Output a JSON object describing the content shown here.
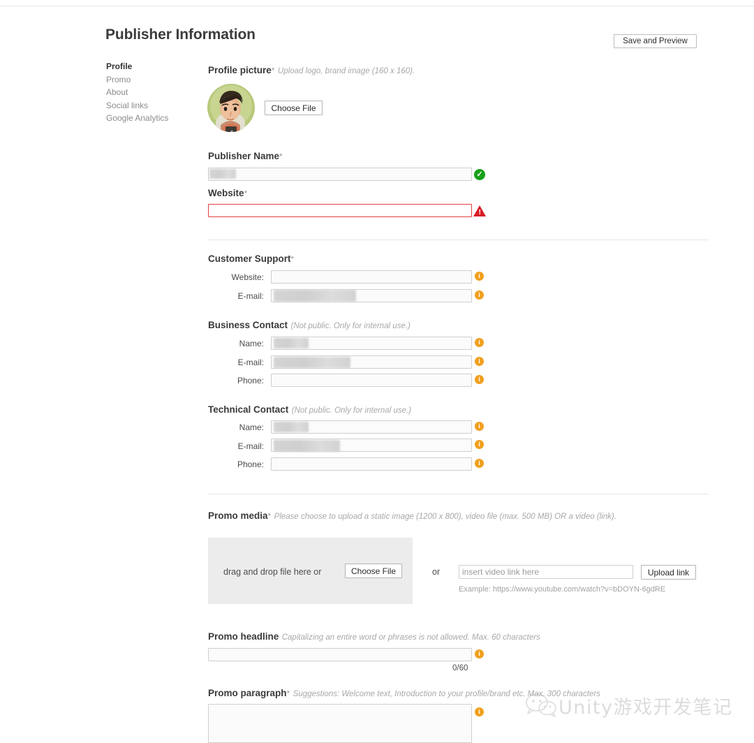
{
  "header": {
    "title": "Publisher Information",
    "save_preview_label": "Save and Preview"
  },
  "sidebar": {
    "items": [
      {
        "label": "Profile",
        "active": true
      },
      {
        "label": "Promo",
        "active": false
      },
      {
        "label": "About",
        "active": false
      },
      {
        "label": "Social links",
        "active": false
      },
      {
        "label": "Google Analytics",
        "active": false
      }
    ]
  },
  "profile_picture": {
    "label": "Profile picture",
    "required_marker": "*",
    "hint": "Upload logo, brand image (160 x 160).",
    "choose_file_label": "Choose File"
  },
  "publisher_name": {
    "label": "Publisher Name",
    "required_marker": "*",
    "value": "",
    "status": "valid",
    "status_icon": "check-circle-icon"
  },
  "website": {
    "label": "Website",
    "required_marker": "*",
    "value": "",
    "status": "error",
    "status_icon": "warning-triangle-icon"
  },
  "customer_support": {
    "label": "Customer Support",
    "required_marker": "*",
    "fields": [
      {
        "label": "Website:",
        "value": "",
        "redacted": false,
        "info_icon": "info-icon"
      },
      {
        "label": "E-mail:",
        "value": ".com",
        "redacted": true,
        "info_icon": "info-icon"
      }
    ]
  },
  "business_contact": {
    "label": "Business Contact",
    "hint": "(Not public. Only for internal use.)",
    "fields": [
      {
        "label": "Name:",
        "value": "",
        "redacted": true,
        "info_icon": "info-icon"
      },
      {
        "label": "E-mail:",
        "value": ".com",
        "redacted": true,
        "info_icon": "info-icon"
      },
      {
        "label": "Phone:",
        "value": "",
        "redacted": false,
        "info_icon": "info-icon"
      }
    ]
  },
  "technical_contact": {
    "label": "Technical Contact",
    "hint": "(Not public. Only for internal use.)",
    "fields": [
      {
        "label": "Name:",
        "value": "",
        "redacted": true,
        "info_icon": "info-icon"
      },
      {
        "label": "E-mail:",
        "value": ".com",
        "redacted": true,
        "info_icon": "info-icon"
      },
      {
        "label": "Phone:",
        "value": "",
        "redacted": false,
        "info_icon": "info-icon"
      }
    ]
  },
  "promo_media": {
    "label": "Promo media",
    "required_marker": "*",
    "hint": "Please choose to upload a static image (1200 x 800), video file (max. 500 MB) OR a video (link).",
    "dropzone_text": "drag and drop file here or",
    "choose_file_label": "Choose File",
    "or_text": "or",
    "video_link_placeholder": "insert video link here",
    "video_link_value": "",
    "upload_link_label": "Upload link",
    "example_text": "Example: https://www.youtube.com/watch?v=bDOYN-6gdRE"
  },
  "promo_headline": {
    "label": "Promo headline",
    "hint": "Capitalizing an entire word or phrases is not allowed. Max. 60 characters",
    "value": "",
    "counter": "0/60",
    "info_icon": "info-icon"
  },
  "promo_paragraph": {
    "label": "Promo paragraph",
    "required_marker": "*",
    "hint": "Suggestions: Welcome text, Introduction to your profile/brand etc. Max. 300 characters",
    "value": "",
    "info_icon": "info-icon"
  },
  "watermark": {
    "text": "Unity游戏开发笔记",
    "icon": "wechat-icon"
  },
  "colors": {
    "valid_green": "#17a11a",
    "error_red": "#d81f25",
    "info_orange": "#f0a01e",
    "field_border": "#cfcfcf",
    "dropzone_bg": "#ececec"
  }
}
